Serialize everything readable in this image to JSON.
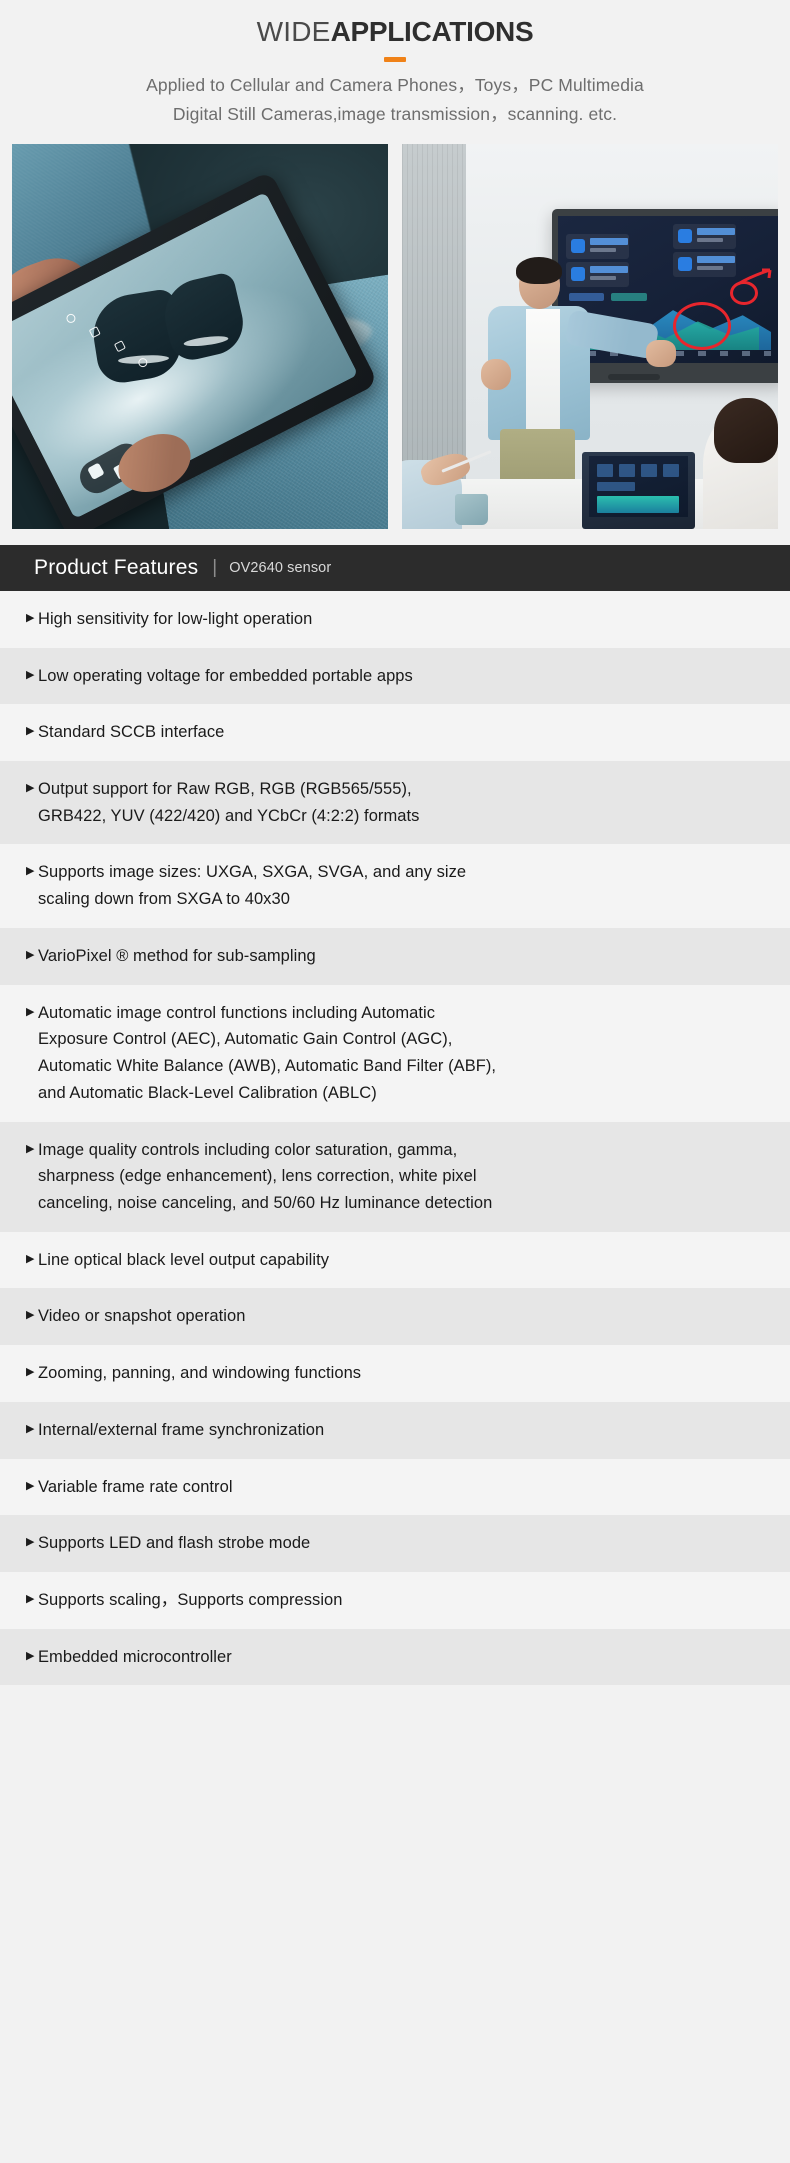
{
  "header": {
    "title_light": "WIDE",
    "title_bold": "APPLICATIONS",
    "subtitle_line1": "Applied to Cellular and Camera Phones，Toys，PC Multimedia",
    "subtitle_line2": "Digital Still Cameras,image transmission，scanning. etc.",
    "accent_color": "#f08218"
  },
  "photos": [
    {
      "alt": "Hand holding a smartphone running a camera app photographing sneakers, wearing ripped blue denim jeans"
    },
    {
      "alt": "Man presenting a data dashboard on an interactive smartboard to colleagues seated at a conference table"
    }
  ],
  "features": {
    "heading": "Product Features",
    "separator": "|",
    "subheading": "OV2640 sensor",
    "bullet_glyph": "▶",
    "header_bg": "#2c2c2c",
    "row_bg_odd": "#f4f4f4",
    "row_bg_even": "#e6e6e6",
    "items": [
      "High sensitivity for low-light operation",
      "Low operating voltage for embedded portable apps",
      "Standard SCCB interface",
      "Output support for Raw RGB, RGB (RGB565/555),\nGRB422, YUV (422/420) and YCbCr (4:2:2) formats",
      "Supports image sizes: UXGA, SXGA, SVGA, and any size\n scaling down from SXGA to 40x30",
      "VarioPixel ® method for sub-sampling",
      "Automatic image control functions including Automatic\nExposure Control (AEC), Automatic Gain Control (AGC),\nAutomatic White Balance (AWB), Automatic Band Filter (ABF),\nand Automatic Black-Level Calibration (ABLC)",
      "Image quality controls including color saturation, gamma,\nsharpness (edge enhancement), lens correction, white pixel\ncanceling, noise canceling, and 50/60 Hz luminance detection",
      "Line optical black level output capability",
      "Video or snapshot operation",
      "Zooming, panning, and windowing functions",
      "Internal/external frame synchronization",
      "Variable frame rate control",
      "Supports LED and flash strobe mode",
      "Supports scaling，Supports compression",
      "Embedded microcontroller"
    ]
  }
}
